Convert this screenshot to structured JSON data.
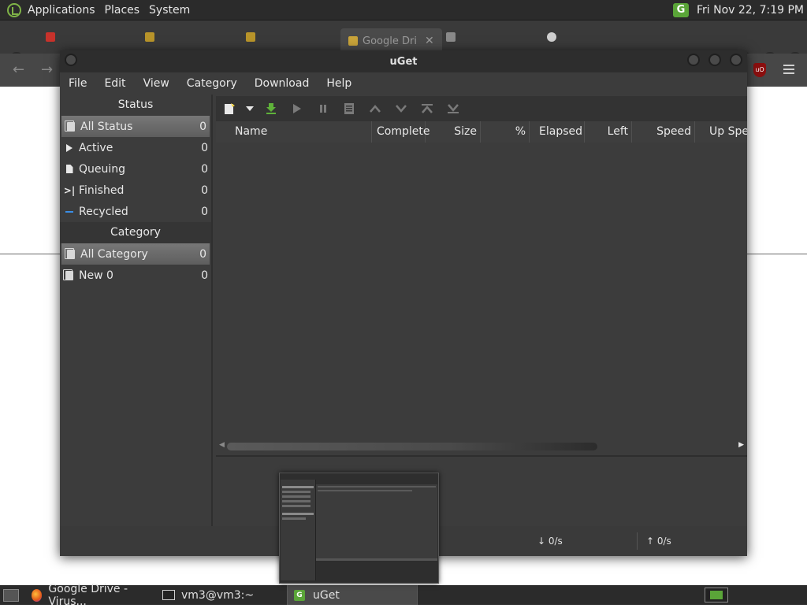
{
  "top_panel": {
    "menu": [
      "Applications",
      "Places",
      "System"
    ],
    "tray_icon": "uget-tray-icon",
    "clock": "Fri Nov 22,  7:19 PM"
  },
  "browser": {
    "active_tab_title": "Google Dri",
    "close_glyph": "✕"
  },
  "uget": {
    "title": "uGet",
    "menu": [
      "File",
      "Edit",
      "View",
      "Category",
      "Download",
      "Help"
    ],
    "status_header": "Status",
    "status_items": [
      {
        "label": "All Status",
        "count": "0",
        "icon": "all-status-icon"
      },
      {
        "label": "Active",
        "count": "0",
        "icon": "play-icon"
      },
      {
        "label": "Queuing",
        "count": "0",
        "icon": "queue-icon"
      },
      {
        "label": "Finished",
        "count": "0",
        "icon": "finished-icon"
      },
      {
        "label": "Recycled",
        "count": "0",
        "icon": "recycled-icon"
      }
    ],
    "category_header": "Category",
    "category_items": [
      {
        "label": "All Category",
        "count": "0",
        "icon": "all-category-icon"
      },
      {
        "label": "New 0",
        "count": "0",
        "icon": "category-icon"
      }
    ],
    "columns": [
      "Name",
      "Complete",
      "Size",
      "%",
      "Elapsed",
      "Left",
      "Speed",
      "Up Speed"
    ],
    "download_speed": "↓  0/s",
    "upload_speed": "↑  0/s"
  },
  "taskbar": {
    "tasks": [
      {
        "label": "Google Drive - Virus...",
        "icon": "firefox-icon"
      },
      {
        "label": "vm3@vm3:~",
        "icon": "terminal-icon"
      },
      {
        "label": "uGet",
        "icon": "uget-icon"
      }
    ]
  }
}
